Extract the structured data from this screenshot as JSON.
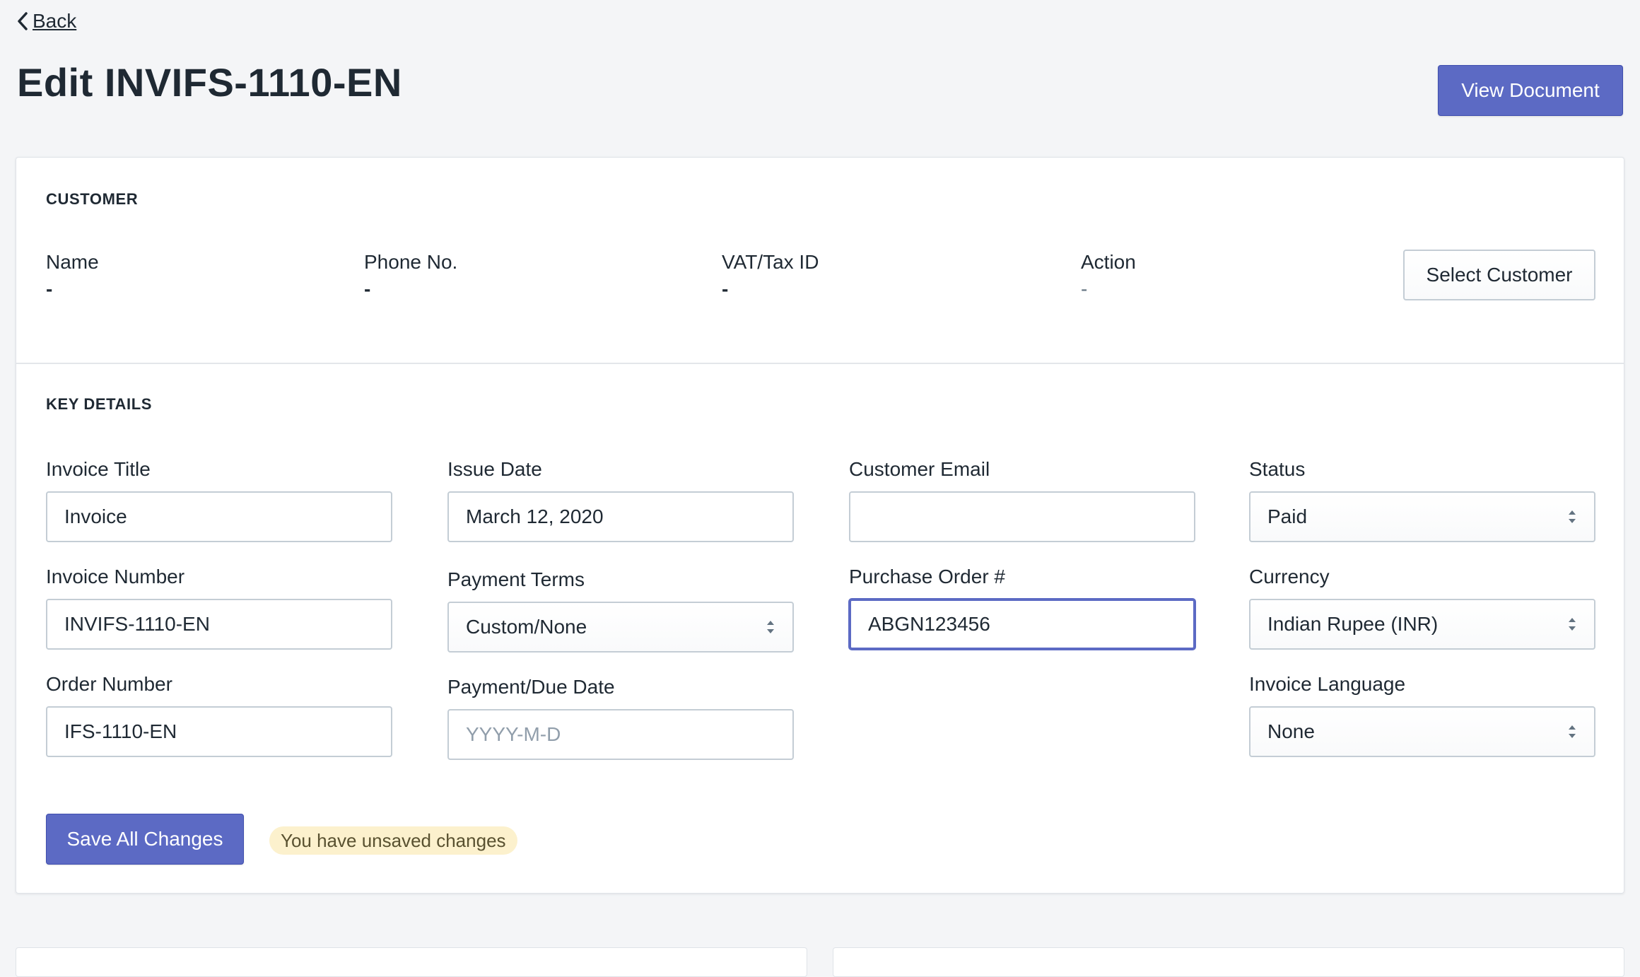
{
  "nav": {
    "back_label": "Back"
  },
  "header": {
    "title": "Edit INVIFS-1110-EN",
    "view_document_label": "View Document"
  },
  "customer": {
    "heading": "CUSTOMER",
    "name_label": "Name",
    "name_value": "-",
    "phone_label": "Phone No.",
    "phone_value": "-",
    "vat_label": "VAT/Tax ID",
    "vat_value": "-",
    "action_label": "Action",
    "action_value": "-",
    "select_button_label": "Select Customer"
  },
  "key_details": {
    "heading": "KEY DETAILS",
    "invoice_title": {
      "label": "Invoice Title",
      "value": "Invoice"
    },
    "invoice_number": {
      "label": "Invoice Number",
      "value": "INVIFS-1110-EN"
    },
    "order_number": {
      "label": "Order Number",
      "value": "IFS-1110-EN"
    },
    "issue_date": {
      "label": "Issue Date",
      "value": "March 12, 2020"
    },
    "payment_terms": {
      "label": "Payment Terms",
      "value": "Custom/None"
    },
    "due_date": {
      "label": "Payment/Due Date",
      "value": "",
      "placeholder": "YYYY-M-D"
    },
    "customer_email": {
      "label": "Customer Email",
      "value": ""
    },
    "purchase_order": {
      "label": "Purchase Order #",
      "value": "ABGN123456"
    },
    "status": {
      "label": "Status",
      "value": "Paid"
    },
    "currency": {
      "label": "Currency",
      "value": "Indian Rupee (INR)"
    },
    "invoice_language": {
      "label": "Invoice Language",
      "value": "None"
    }
  },
  "footer": {
    "save_label": "Save All Changes",
    "unsaved_notice": "You have unsaved changes"
  },
  "colors": {
    "accent": "#5c6ac4",
    "background": "#f4f5f7",
    "badge_bg": "#fcf1cd"
  }
}
